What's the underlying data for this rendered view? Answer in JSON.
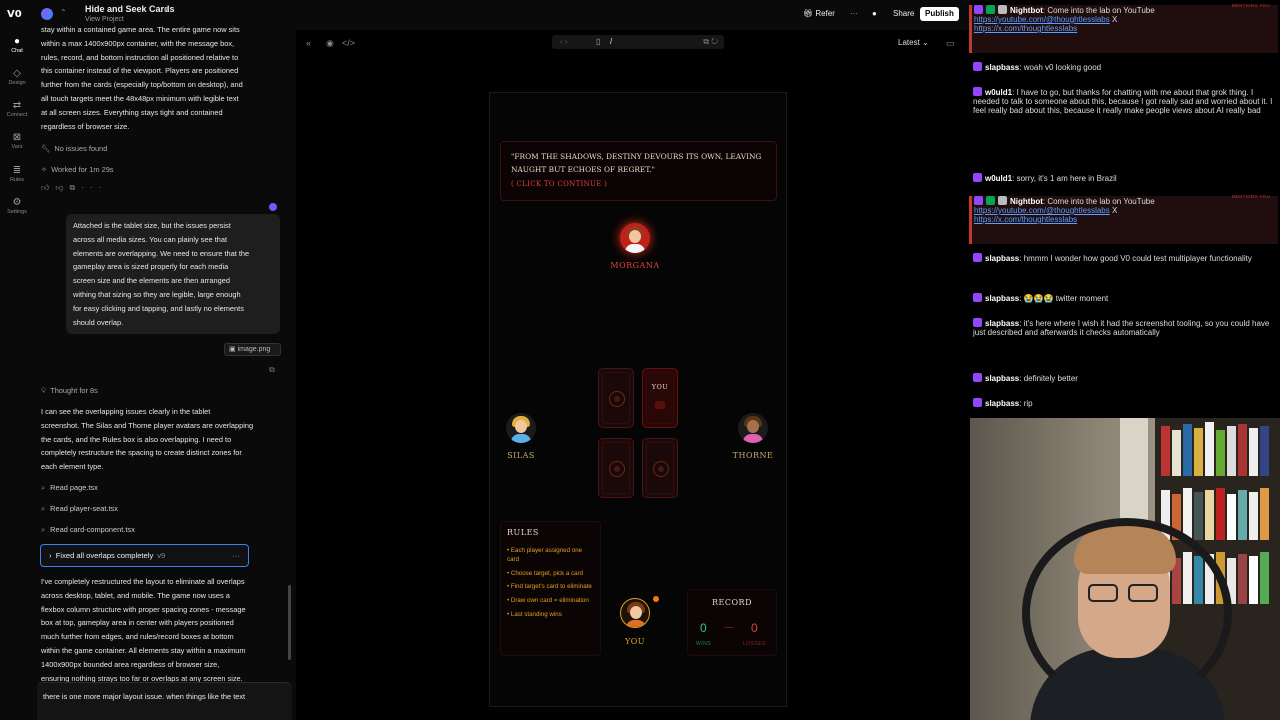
{
  "rail": {
    "logo": "V0",
    "items": [
      {
        "icon": "●",
        "label": "Chat"
      },
      {
        "icon": "◇",
        "label": "Design"
      },
      {
        "icon": "⇄",
        "label": "Connect"
      },
      {
        "icon": "⊠",
        "label": "Vars"
      },
      {
        "icon": "≣",
        "label": "Rules"
      },
      {
        "icon": "⚙",
        "label": "Settings"
      }
    ]
  },
  "topbar": {
    "project_title": "Hide and Seek Cards",
    "project_sub": "View Project",
    "refer": "Refer",
    "more": "···",
    "share": "Share",
    "publish": "Publish"
  },
  "chat": {
    "intro_lines": [
      "stay within a contained game area. The entire game now sits",
      "within a max 1400x900px container, with the message box,",
      "rules, record, and bottom instruction all positioned relative to",
      "this container instead of the viewport. Players are positioned",
      "further from the cards (especially top/bottom on desktop), and",
      "all touch targets meet the 48x48px minimum with legible text",
      "at all screen sizes. Everything stays tight and contained",
      "regardless of browser size."
    ],
    "no_issues": "No issues found",
    "worked_for": "Worked for 1m 29s",
    "user_message_lines": [
      "Attached is the tablet size, but the issues persist",
      "across all media sizes. You can plainly see that",
      "elements are overlapping. We need to ensure that the",
      "gameplay area is sized properly for each media",
      "screen size and the elements are then arranged",
      "withing that sizing so they are legible, large enough",
      "for easy clicking and tapping, and lastly no elements",
      "should overlap."
    ],
    "attachment": "image.png",
    "thought": "Thought for 8s",
    "analysis_lines": [
      "I can see the overlapping issues clearly in the tablet",
      "screenshot. The Silas and Thorne player avatars are overlapping",
      "the cards, and the Rules box is also overlapping. I need to",
      "completely restructure the spacing to create distinct zones for",
      "each element type."
    ],
    "files_read": [
      "Read page.tsx",
      "Read player-seat.tsx",
      "Read card-component.tsx"
    ],
    "version_label": "Fixed all overlaps completely",
    "version_tag": "v9",
    "summary_lines": [
      "I've completely restructured the layout to eliminate all overlaps",
      "across desktop, tablet, and mobile. The game now uses a",
      "flexbox column structure with proper spacing zones - message",
      "box at top, gameplay area in center with players positioned",
      "much further from edges, and rules/record boxes at bottom",
      "within the game container. All elements stay within a maximum",
      "1400x900px bounded area regardless of browser size,",
      "ensuring nothing strays too far or overlaps at any screen size."
    ],
    "input_text": "there is one more major layout issue. when things like the text"
  },
  "preview": {
    "url_path": "/",
    "version_select": "Latest"
  },
  "game": {
    "quote": "\"FROM THE SHADOWS, DESTINY DEVOURS ITS OWN, LEAVING NAUGHT BUT ECHOES OF REGRET.\"",
    "continue_prompt": "( CLICK TO CONTINUE )",
    "players": {
      "top": "MORGANA",
      "left": "SILAS",
      "right": "THORNE",
      "bottom": "YOU"
    },
    "you_card_label": "YOU",
    "rules_title": "RULES",
    "rules": [
      "• Each player assigned one card",
      "• Choose target, pick a card",
      "• Find target's card to eliminate",
      "• Draw own card = elimination",
      "• Last standing wins"
    ],
    "record": {
      "title": "RECORD",
      "wins": "0",
      "losses": "0",
      "dash": "—",
      "wins_label": "WINS",
      "losses_label": "LOSSES"
    },
    "colors": {
      "accent_red": "#e0423a",
      "gold": "#e0a020",
      "win_green": "#2ecc71"
    }
  },
  "twitch": {
    "mention_tag": "MENTIONS YOU",
    "messages": [
      {
        "user": "Nightbot",
        "text": "Come into the lab on YouTube",
        "links": [
          "https://youtube.com/@thoughtlesslabs",
          "https://x.com/thoughtlesslabs"
        ],
        "sep": "X"
      },
      {
        "user": "slapbass",
        "text": "woah v0 looking good"
      },
      {
        "user": "w0uld1",
        "text": "I have to go, but thanks for chatting with me about that grok thing. I needed to talk to someone about this, because I got really sad and worried about it. I feel really bad about this, because it really make people views about AI really bad"
      },
      {
        "user": "w0uld1",
        "text": "sorry, it's 1 am here in Brazil"
      },
      {
        "user": "Nightbot",
        "text": "Come into the lab on YouTube",
        "links": [
          "https://youtube.com/@thoughtlesslabs",
          "https://x.com/thoughtlesslabs"
        ],
        "sep": "X"
      },
      {
        "user": "slapbass",
        "text": "hmmm I wonder how good V0 could test multiplayer functionality"
      },
      {
        "user": "slapbass",
        "text": "😭😭😭 twitter moment"
      },
      {
        "user": "slapbass",
        "text": "it's here where I wish it had the screenshot tooling, so you could have just described and afterwards it checks automatically"
      },
      {
        "user": "slapbass",
        "text": "definitely better"
      },
      {
        "user": "slapbass",
        "text": "rip"
      }
    ]
  }
}
